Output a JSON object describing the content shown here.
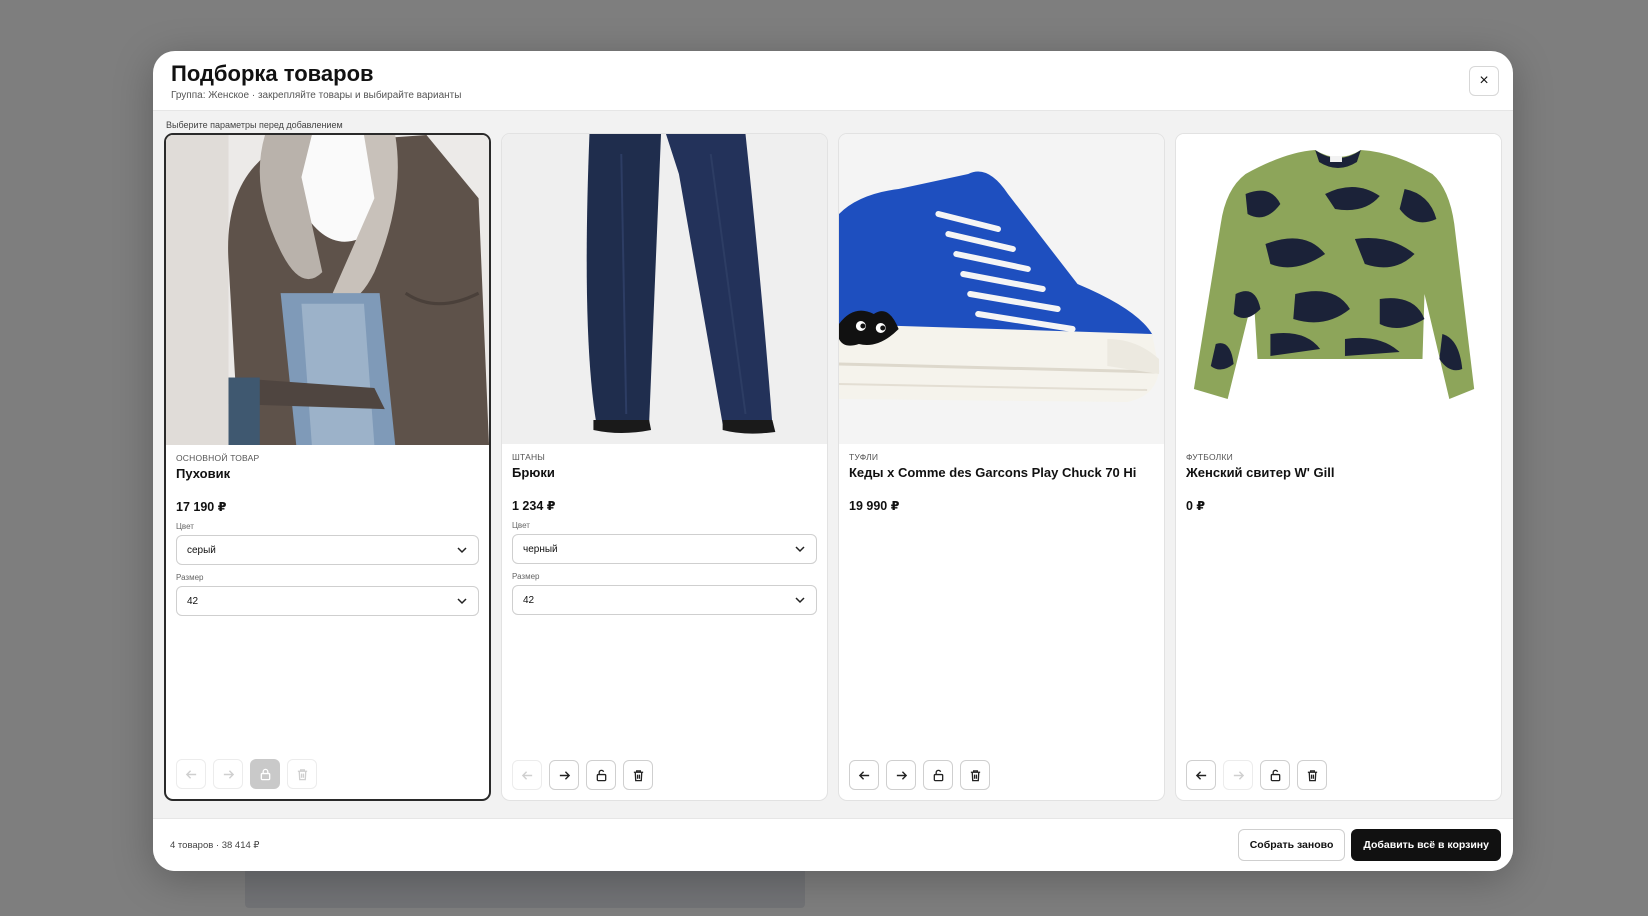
{
  "modal": {
    "title": "Подборка товаров",
    "subtitle": "Группа: Женское · закрепляйте товары и выбирайте варианты",
    "close_label": "×",
    "hint": "Выберите параметры перед добавлением"
  },
  "cards": [
    {
      "category": "ОСНОВНОЙ ТОВАР",
      "name": "Пуховик",
      "price": "17 190 ₽",
      "color_label": "Цвет",
      "color_value": "серый",
      "size_label": "Размер",
      "size_value": "42",
      "image": "brown-puffer-jacket-image",
      "locked": true
    },
    {
      "category": "ШТАНЫ",
      "name": "Брюки",
      "price": "1 234 ₽",
      "color_label": "Цвет",
      "color_value": "черный",
      "size_label": "Размер",
      "size_value": "42",
      "image": "navy-wide-trousers-image",
      "locked": false
    },
    {
      "category": "ТУФЛИ",
      "name": "Кеды x Comme des Garcons Play Chuck 70 Hi",
      "price": "19 990 ₽",
      "image": "blue-high-top-sneaker-image",
      "locked": false
    },
    {
      "category": "ФУТБОЛКИ",
      "name": "Женский свитер W' Gill",
      "price": "0 ₽",
      "image": "green-navy-knit-sweater-image",
      "locked": false
    }
  ],
  "footer": {
    "summary": "4 товаров · 38 414 ₽",
    "rebuild_label": "Собрать заново",
    "add_all_label": "Добавить всё в корзину"
  },
  "colors": {
    "primary_button": "#111111",
    "modal_bg": "#ffffff",
    "body_bg": "#f2f2f2",
    "overlay": "#7e7e7e"
  }
}
